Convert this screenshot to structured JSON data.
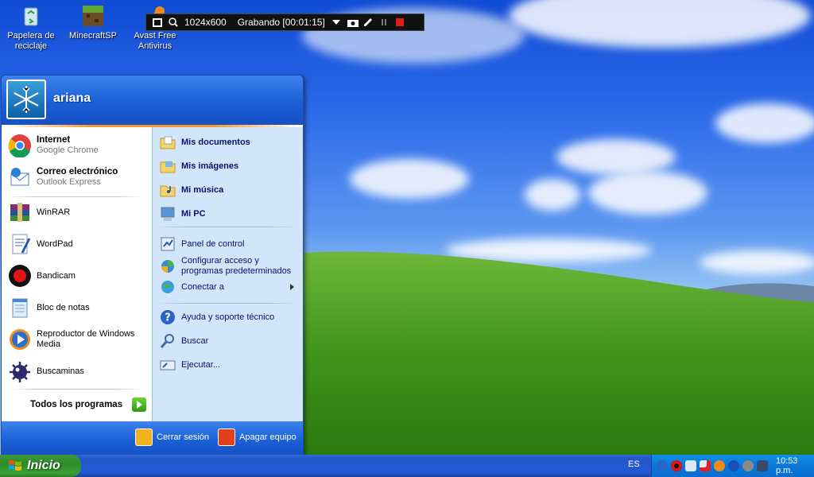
{
  "recorder": {
    "resolution": "1024x600",
    "status": "Grabando [00:01:15]"
  },
  "desktop_icons": [
    {
      "label": "Papelera de reciclaje"
    },
    {
      "label": "MinecraftSP"
    },
    {
      "label": "Avast Free Antivirus"
    }
  ],
  "start_menu": {
    "user": "ariana",
    "pinned": [
      {
        "title": "Internet",
        "subtitle": "Google Chrome"
      },
      {
        "title": "Correo electrónico",
        "subtitle": "Outlook Express"
      }
    ],
    "recent": [
      {
        "label": "WinRAR"
      },
      {
        "label": "WordPad"
      },
      {
        "label": "Bandicam"
      },
      {
        "label": "Bloc de notas"
      },
      {
        "label": "Reproductor de Windows Media"
      },
      {
        "label": "Buscaminas"
      }
    ],
    "all_programs": "Todos los programas",
    "right_group1": [
      "Mis documentos",
      "Mis imágenes",
      "Mi música",
      "Mi PC"
    ],
    "right_group2": [
      "Panel de control",
      "Configurar acceso y programas predeterminados",
      "Conectar a"
    ],
    "right_group3": [
      "Ayuda y soporte técnico",
      "Buscar",
      "Ejecutar..."
    ],
    "logoff": "Cerrar sesión",
    "shutdown": "Apagar equipo"
  },
  "taskbar": {
    "start_label": "Inicio",
    "language": "ES",
    "clock": "10:53 p.m."
  },
  "colors": {
    "xp_blue": "#1a5fd6",
    "start_green": "#3c9b38",
    "tray_blue": "#0b77d8"
  }
}
